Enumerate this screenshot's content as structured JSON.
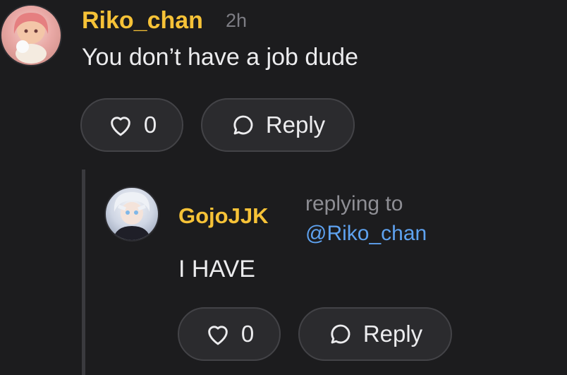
{
  "comment": {
    "username": "Riko_chan",
    "time": "2h",
    "body": "You don’t have a job dude",
    "like_count": "0",
    "reply_label": "Reply"
  },
  "reply": {
    "username": "GojoJJK",
    "replying_label": "replying to",
    "replying_to": "@Riko_chan",
    "body": "I HAVE",
    "like_count": "0",
    "reply_label": "Reply"
  },
  "colors": {
    "background": "#1c1c1e",
    "username": "#f6c237",
    "mention": "#5ea2f0",
    "muted": "#8e8e94",
    "pill": "#2b2b2e"
  },
  "icons": [
    "heart-icon",
    "speech-bubble-icon"
  ]
}
